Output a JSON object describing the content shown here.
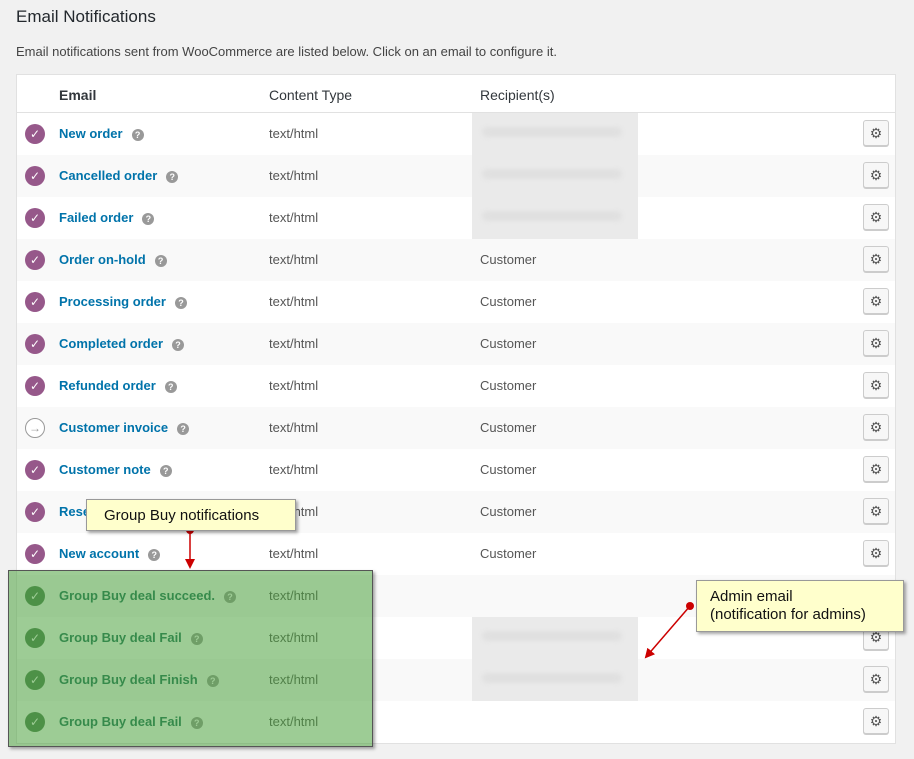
{
  "page": {
    "title": "Email Notifications",
    "description": "Email notifications sent from WooCommerce are listed below. Click on an email to configure it."
  },
  "table": {
    "headers": {
      "email": "Email",
      "content_type": "Content Type",
      "recipients": "Recipient(s)"
    },
    "rows": [
      {
        "name": "New order",
        "content_type": "text/html",
        "recipient": "",
        "recipient_hidden": true,
        "status": "enabled"
      },
      {
        "name": "Cancelled order",
        "content_type": "text/html",
        "recipient": "",
        "recipient_hidden": true,
        "status": "enabled"
      },
      {
        "name": "Failed order",
        "content_type": "text/html",
        "recipient": "",
        "recipient_hidden": true,
        "status": "enabled"
      },
      {
        "name": "Order on-hold",
        "content_type": "text/html",
        "recipient": "Customer",
        "status": "enabled"
      },
      {
        "name": "Processing order",
        "content_type": "text/html",
        "recipient": "Customer",
        "status": "enabled"
      },
      {
        "name": "Completed order",
        "content_type": "text/html",
        "recipient": "Customer",
        "status": "enabled"
      },
      {
        "name": "Refunded order",
        "content_type": "text/html",
        "recipient": "Customer",
        "status": "enabled"
      },
      {
        "name": "Customer invoice",
        "content_type": "text/html",
        "recipient": "Customer",
        "status": "manual"
      },
      {
        "name": "Customer note",
        "content_type": "text/html",
        "recipient": "Customer",
        "status": "enabled"
      },
      {
        "name": "Reset password",
        "content_type": "text/html",
        "recipient": "Customer",
        "status": "enabled"
      },
      {
        "name": "New account",
        "content_type": "text/html",
        "recipient": "Customer",
        "status": "enabled"
      },
      {
        "name": "Group Buy deal succeed.",
        "content_type": "text/html",
        "recipient": "",
        "status": "group"
      },
      {
        "name": "Group Buy deal Fail",
        "content_type": "text/html",
        "recipient": "",
        "recipient_hidden": true,
        "status": "group"
      },
      {
        "name": "Group Buy deal Finish",
        "content_type": "text/html",
        "recipient": "",
        "recipient_hidden": true,
        "status": "group"
      },
      {
        "name": "Group Buy deal Fail",
        "content_type": "text/html",
        "recipient": "",
        "status": "group"
      }
    ]
  },
  "annotations": {
    "group_buy": "Group Buy notifications",
    "admin_line1": "Admin email",
    "admin_line2": "(notification for admins)"
  },
  "icons": {
    "status_enabled": "check-circle-icon",
    "status_manual": "arrow-circle-icon",
    "help": "help-icon",
    "configure": "gear-icon"
  },
  "colors": {
    "enabled": "#96588a",
    "link": "#0073aa",
    "group_highlight": "#4ca33e",
    "callout_bg": "#ffffcc",
    "arrow": "#cc0000"
  }
}
